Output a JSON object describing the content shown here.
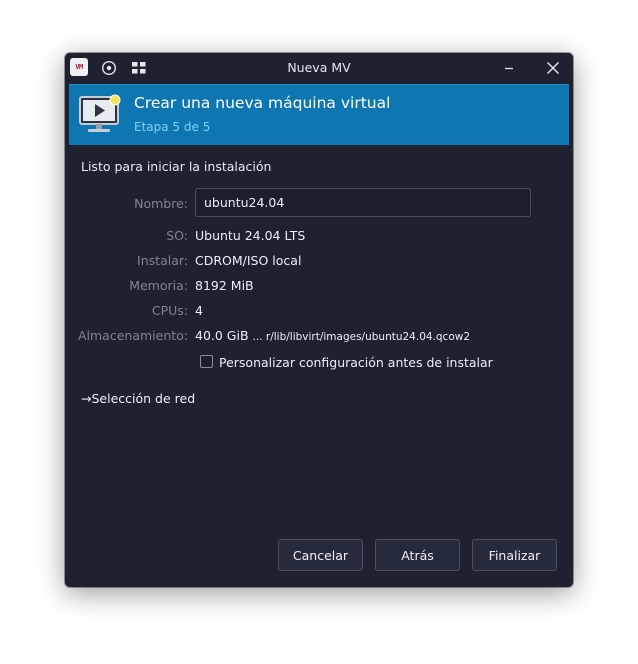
{
  "window": {
    "title": "Nueva MV",
    "app_logo_text": "VM"
  },
  "banner": {
    "title": "Crear una nueva máquina virtual",
    "subtitle": "Etapa 5 de 5"
  },
  "summary": {
    "heading": "Listo para iniciar la instalación",
    "name_label": "Nombre:",
    "name_value": "ubuntu24.04",
    "os_label": "SO:",
    "os_value": "Ubuntu 24.04 LTS",
    "install_label": "Instalar:",
    "install_value": "CDROM/ISO local",
    "memory_label": "Memoria:",
    "memory_value": "8192 MiB",
    "cpus_label": "CPUs:",
    "cpus_value": "4",
    "storage_label": "Almacenamiento:",
    "storage_size": "40.0 GiB",
    "storage_path": "... r/lib/libvirt/images/ubuntu24.04.qcow2",
    "customize_label": "Personalizar configuración antes de instalar",
    "customize_checked": false
  },
  "network": {
    "expander_label": "Selección de red"
  },
  "buttons": {
    "cancel": "Cancelar",
    "back": "Atrás",
    "finish": "Finalizar"
  },
  "colors": {
    "banner_bg": "#0e77b1",
    "window_bg": "#1d2130"
  },
  "icons": {
    "app": "virt-manager-logo-icon",
    "tb1": "record-icon",
    "tb2": "grid-icon",
    "minimize": "minimize-icon",
    "close": "close-icon",
    "banner": "new-vm-monitor-icon",
    "expander": "arrow-right-icon"
  }
}
